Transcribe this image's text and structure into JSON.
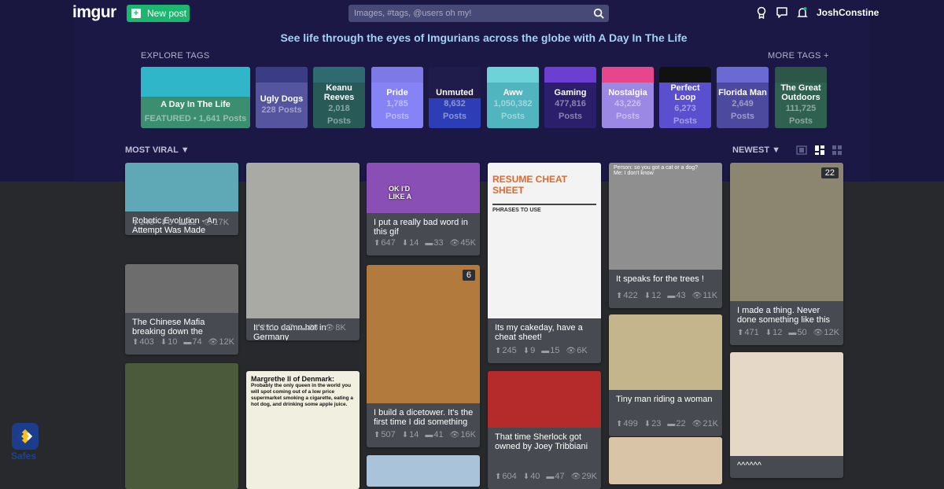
{
  "header": {
    "logo": "imgur",
    "new_post_label": "New post",
    "search_placeholder": "Images, #tags, @users oh my!",
    "username": "JoshConstine",
    "icons": [
      "search-icon",
      "medal-icon",
      "chat-icon",
      "bell-icon"
    ]
  },
  "banner": "See life through the eyes of Imgurians across the globe with A Day In The Life",
  "explore_tags": {
    "label": "EXPLORE TAGS",
    "more_label": "MORE TAGS +",
    "tags": [
      {
        "name": "A Day In The Life",
        "count": "FEATURED • 1,641 Posts",
        "color": "#3b8e6f",
        "art": "#2fb6c9"
      },
      {
        "name": "Ugly Dogs",
        "count": "228 Posts",
        "color": "#55559f",
        "art": "#3a3c85"
      },
      {
        "name": "Keanu Reeves",
        "count": "2,018",
        "count2": "Posts",
        "color": "#285a58",
        "art": "#2f6a70"
      },
      {
        "name": "Pride",
        "count": "1,785",
        "count2": "Posts",
        "color": "#8583f5",
        "art": "#7d79e6"
      },
      {
        "name": "Unmuted",
        "count": "8,632",
        "count2": "Posts",
        "color": "#2c3db6",
        "art": "#1f1b4a"
      },
      {
        "name": "Aww",
        "count": "1,050,382",
        "count2": "Posts",
        "color": "#50b5bf",
        "art": "#6fd2d8"
      },
      {
        "name": "Gaming",
        "count": "477,816",
        "count2": "Posts",
        "color": "#2b1e6b",
        "art": "#6c3fd0"
      },
      {
        "name": "Nostalgia",
        "count": "43,226",
        "count2": "Posts",
        "color": "#9b87e4",
        "art": "#e8468c"
      },
      {
        "name": "Perfect Loop",
        "count": "6,273",
        "count2": "Posts",
        "color": "#5a4fcf",
        "art": "#111"
      },
      {
        "name": "Florida Man",
        "count": "2,649",
        "count2": "Posts",
        "color": "#4c4a9e",
        "art": "#6b6ad5"
      },
      {
        "name": "The Great Outdoors",
        "count": "111,725",
        "count2": "Posts",
        "color": "#2f6150",
        "art": "#2b5648"
      }
    ]
  },
  "sort": {
    "left": "MOST VIRAL",
    "right": "NEWEST"
  },
  "posts": [
    {
      "col": 0,
      "title": "Robotic Evolution - An Attempt Was Made",
      "up": "146",
      "down": "6",
      "comments": "11",
      "views": "17K",
      "img": "#5fa8b5"
    },
    {
      "col": 0,
      "title": "The Chinese Mafia breaking down the",
      "up": "403",
      "down": "10",
      "comments": "74",
      "views": "12K",
      "img": "#6d6d6d"
    },
    {
      "col": 0,
      "title": "",
      "img": "#4a5a3a"
    },
    {
      "col": 1,
      "title": "It's too damn hot in Germany",
      "up": "251",
      "down": "7",
      "comments": "68",
      "views": "8K",
      "img": "#a9aaa4"
    },
    {
      "col": 1,
      "title": "",
      "img": "#f1efe0",
      "caption_title": "Margrethe II of Denmark:",
      "caption": "Probably the only queen in the world you will spot coming out of a low price supermarket smoking a cigarette, eating a hot dog, and drinking some apple juice."
    },
    {
      "col": 2,
      "title": "I put a really bad word in this gif",
      "up": "647",
      "down": "14",
      "comments": "33",
      "views": "45K",
      "img": "#8a4fb5",
      "overlay": "OK I'D LIKE A"
    },
    {
      "col": 2,
      "title": "I build a dicetower. It's the first time I did something",
      "up": "507",
      "down": "14",
      "comments": "41",
      "views": "16K",
      "img": "#b27a3d",
      "badge": "6"
    },
    {
      "col": 2,
      "title": "",
      "img": "#a9c4da"
    },
    {
      "col": 3,
      "title": "Its my cakeday, have a cheat sheet!",
      "up": "245",
      "down": "9",
      "comments": "15",
      "views": "6K",
      "img": "#f3f3f3",
      "sheet_title": "RESUME CHEAT SHEET",
      "sheet_sub": "PHRASES TO USE"
    },
    {
      "col": 3,
      "title": "That time Sherlock got owned by Joey Tribbiani",
      "up": "604",
      "down": "40",
      "comments": "47",
      "views": "29K",
      "img": "#b52a2a"
    },
    {
      "col": 4,
      "title": "It speaks for the trees !",
      "up": "422",
      "down": "12",
      "comments": "43",
      "views": "11K",
      "img": "#8f8f8f",
      "chat1": "Person: so you got a cat or a dog?",
      "chat2": "Me: I don't know"
    },
    {
      "col": 4,
      "title": "Tiny man riding a woman",
      "up": "499",
      "down": "23",
      "comments": "22",
      "views": "21K",
      "img": "#c5b58c"
    },
    {
      "col": 4,
      "title": "",
      "img": "#d9c4a8"
    },
    {
      "col": 5,
      "title": "I made a thing. Never done something like this",
      "up": "471",
      "down": "12",
      "comments": "50",
      "views": "12K",
      "img": "#8c8671",
      "badge": "22"
    },
    {
      "col": 5,
      "title": "^^^^^^",
      "img": "#e6d8c7"
    }
  ],
  "dock": {
    "label": "Safes"
  }
}
